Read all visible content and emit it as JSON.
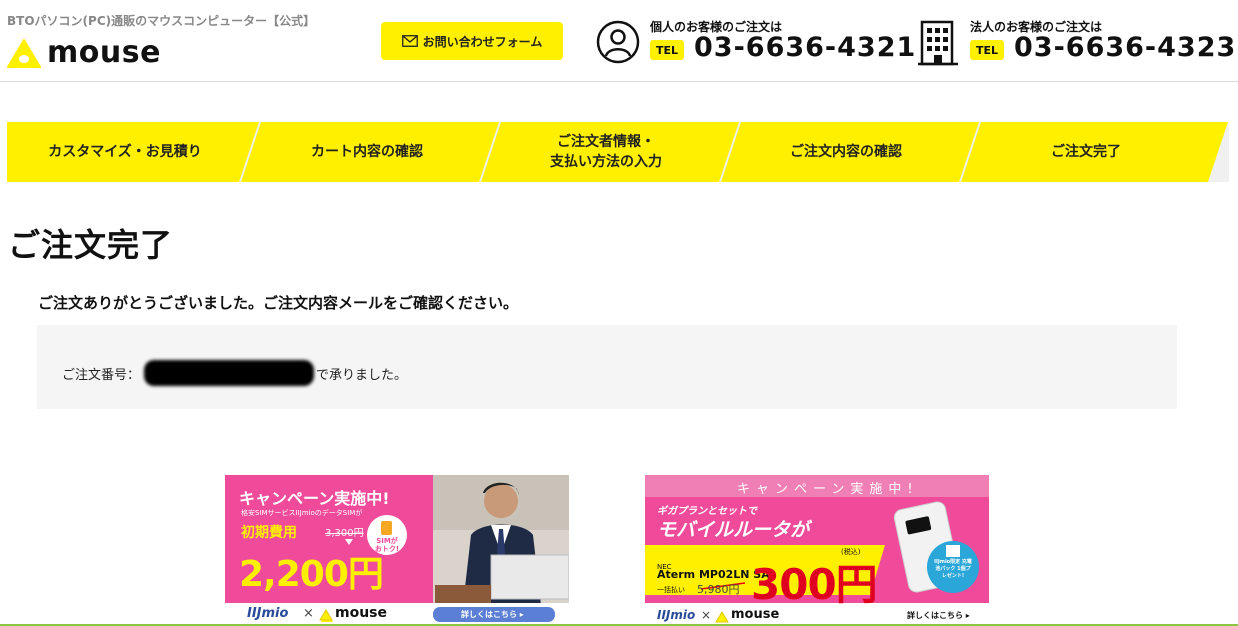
{
  "header": {
    "tagline": "BTOパソコン(PC)通販のマウスコンピューター【公式】",
    "logo_text": "mouse",
    "contact_button": "お問い合わせフォーム",
    "personal": {
      "label": "個人のお客様のご注文は",
      "tel_badge": "TEL",
      "number": "03-6636-4321"
    },
    "corporate": {
      "label": "法人のお客様のご注文は",
      "tel_badge": "TEL",
      "number": "03-6636-4323"
    }
  },
  "steps": [
    {
      "label": "カスタマイズ・お見積り"
    },
    {
      "label": "カート内容の確認"
    },
    {
      "label": "ご注文者情報・\n支払い方法の入力"
    },
    {
      "label": "ご注文内容の確認"
    },
    {
      "label": "ご注文完了"
    }
  ],
  "main": {
    "title": "ご注文完了",
    "thanks": "ご注文ありがとうございました。ご注文内容メールをご確認ください。",
    "order_prefix": "ご注文番号：",
    "order_suffix": "で承りました。"
  },
  "banner1": {
    "headline": "キャンペーン実施中!",
    "sub": "格安SIMサービスIIJmioのデータSIMが",
    "fee_label": "初期費用",
    "old_price": "3,300円",
    "price": "2,200円",
    "badge": "SIMが おトク!",
    "brand_left": "IIJmio",
    "cross": "×",
    "brand_right": "mouse",
    "cta": "詳しくはこちら ▸"
  },
  "banner2": {
    "headline": "キャンペーン実施中!",
    "sub": "ギガプランとセットで",
    "product_type": "モバイルルータが",
    "maker": "NEC",
    "model": "Aterm MP02LN SA",
    "pay_label": "一括払い",
    "old_price": "5,980円",
    "tax_label": "(税込)",
    "price": "300円",
    "badge": "IIJmio限定 充電池パック 1個プレゼント!",
    "brand_left": "IIJmio",
    "cross": "×",
    "brand_right": "mouse",
    "cta": "詳しくはこちら ▸"
  },
  "colors": {
    "accent": "#fff000",
    "banner_pink": "#ef4b9a",
    "footer_green": "#8cc63f",
    "step_gray": "#f0f0f0"
  }
}
